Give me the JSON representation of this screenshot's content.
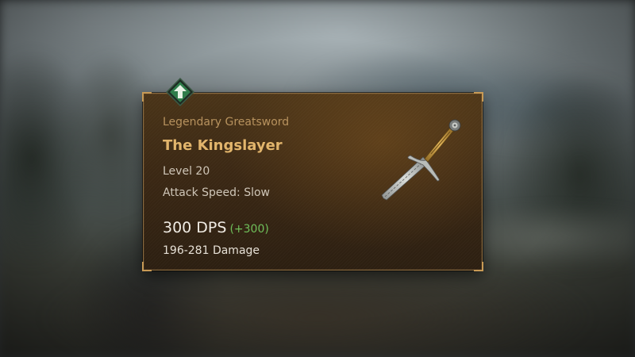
{
  "tooltip": {
    "item_type": "Legendary Greatsword",
    "item_name": "The Kingslayer",
    "level": "Level 20",
    "attack_speed": "Attack Speed: Slow",
    "dps": "300 DPS",
    "dps_diff": "(+300)",
    "damage": "196-281 Damage",
    "upgrade_indicator": "arrow-up-icon",
    "item_icon": "greatsword-icon"
  },
  "colors": {
    "name_gold": "#e2b56c",
    "type_gold": "#b7925e",
    "positive_green": "#6fbf5a",
    "frame_border": "#8a6a3e",
    "badge_green": "#2f7d4a"
  }
}
